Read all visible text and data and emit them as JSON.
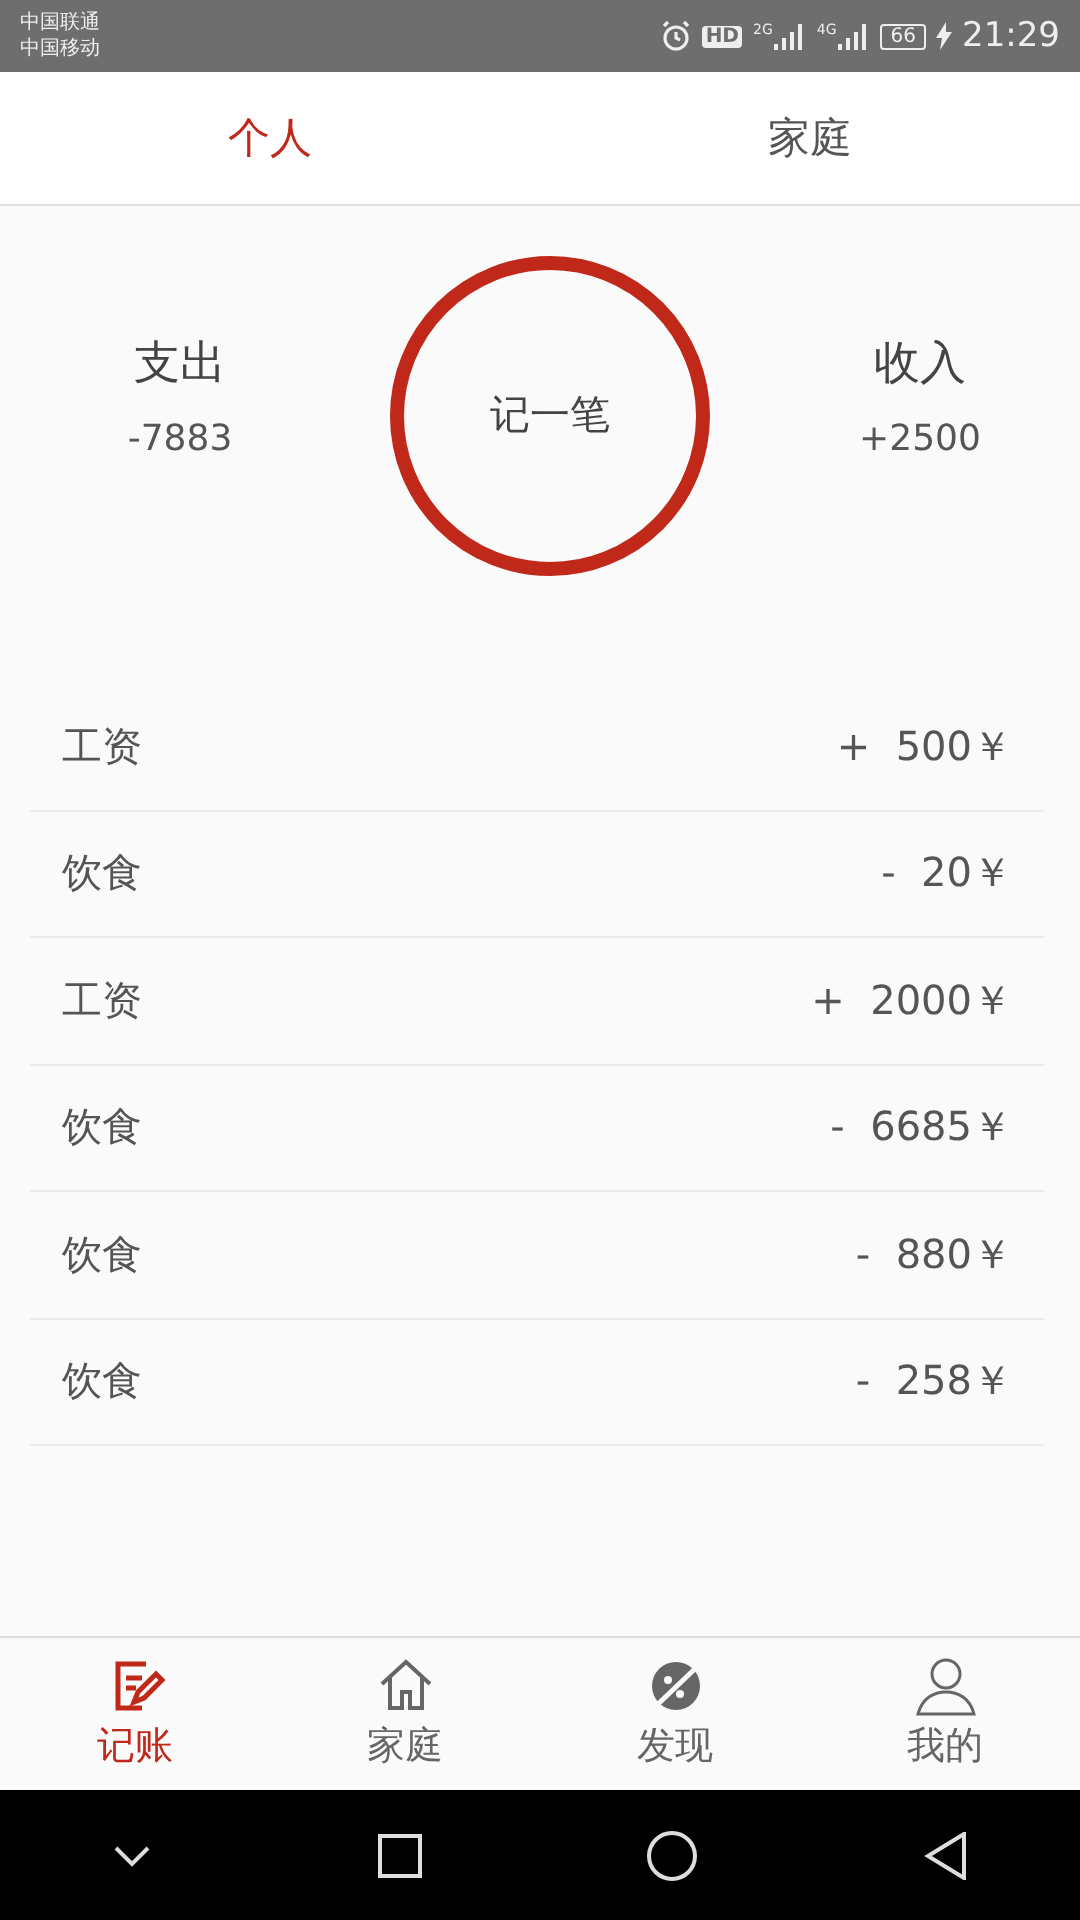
{
  "status_bar": {
    "carriers": [
      "中国联通",
      "中国移动"
    ],
    "hd": "HD",
    "networks": [
      "2G",
      "4G"
    ],
    "battery": "66",
    "time": "21:29"
  },
  "tabs": [
    {
      "label": "个人",
      "selected": true
    },
    {
      "label": "家庭",
      "selected": false
    }
  ],
  "summary": {
    "expense_label": "支出",
    "expense": "-7883",
    "record_button": "记一笔",
    "income_label": "收入",
    "income": "+2500"
  },
  "records": [
    {
      "category": "工资",
      "amount": "+  500￥"
    },
    {
      "category": "饮食",
      "amount": "-  20￥"
    },
    {
      "category": "工资",
      "amount": "+  2000￥"
    },
    {
      "category": "饮食",
      "amount": "-  6685￥"
    },
    {
      "category": "饮食",
      "amount": "-  880￥"
    },
    {
      "category": "饮食",
      "amount": "-  258￥"
    }
  ],
  "bottom_nav": [
    {
      "label": "记账",
      "kind": "note",
      "selected": true
    },
    {
      "label": "家庭",
      "kind": "home",
      "selected": false
    },
    {
      "label": "发现",
      "kind": "planet",
      "selected": false
    },
    {
      "label": "我的",
      "kind": "person",
      "selected": false
    }
  ]
}
